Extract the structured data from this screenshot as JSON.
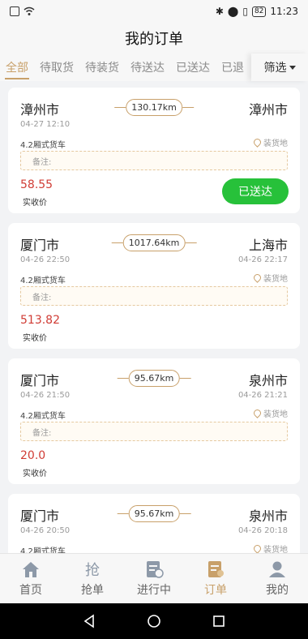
{
  "status_bar": {
    "time": "11:23",
    "battery": "82"
  },
  "title": "我的订单",
  "tabs": [
    "全部",
    "待取货",
    "待装货",
    "待送达",
    "已送达",
    "已退"
  ],
  "filter_label": "筛选",
  "orders": [
    {
      "from": "漳州市",
      "to": "漳州市",
      "distance": "130.17km",
      "time_from": "04-27 12:10",
      "time_to": "",
      "truck": "4.2厢式货车",
      "load_label": "装货地",
      "remark_label": "备注:",
      "price": "58.55",
      "price_label": "实收价",
      "status": "已送达"
    },
    {
      "from": "厦门市",
      "to": "上海市",
      "distance": "1017.64km",
      "time_from": "04-26 22:50",
      "time_to": "04-26 22:17",
      "truck": "4.2厢式货车",
      "load_label": "装货地",
      "remark_label": "备注:",
      "price": "513.82",
      "price_label": "实收价",
      "status": ""
    },
    {
      "from": "厦门市",
      "to": "泉州市",
      "distance": "95.67km",
      "time_from": "04-26 21:50",
      "time_to": "04-26 21:21",
      "truck": "4.2厢式货车",
      "load_label": "装货地",
      "remark_label": "备注:",
      "price": "20.0",
      "price_label": "实收价",
      "status": ""
    },
    {
      "from": "厦门市",
      "to": "泉州市",
      "distance": "95.67km",
      "time_from": "04-26 20:50",
      "time_to": "04-26 20:18",
      "truck": "4.2厢式货车",
      "load_label": "装货地",
      "remark_label": "",
      "price": "",
      "price_label": "",
      "status": ""
    }
  ],
  "bottom_nav": [
    {
      "label": "首页",
      "icon": "home-icon"
    },
    {
      "label": "抢单",
      "icon": "grab-order-icon"
    },
    {
      "label": "进行中",
      "icon": "in-progress-icon"
    },
    {
      "label": "订单",
      "icon": "orders-icon"
    },
    {
      "label": "我的",
      "icon": "profile-icon"
    }
  ],
  "colors": {
    "accent": "#c8a06a",
    "price": "#d03c35",
    "status_green": "#27c13a"
  }
}
